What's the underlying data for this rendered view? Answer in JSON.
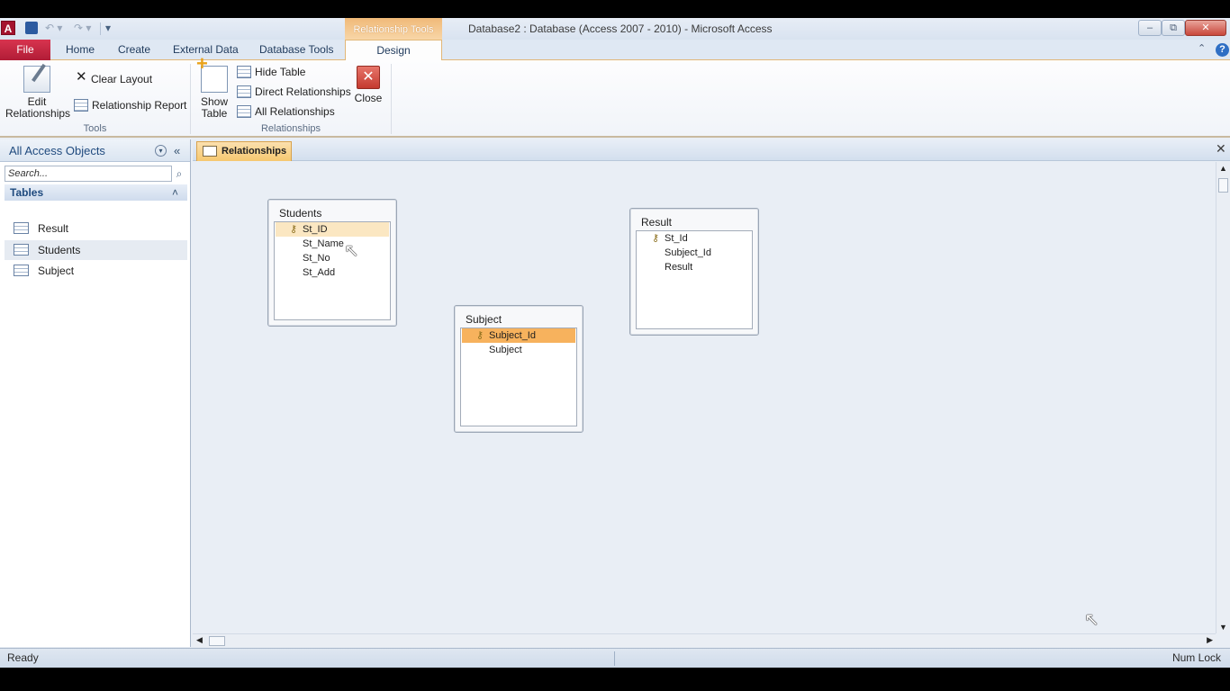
{
  "window": {
    "title": "Database2 : Database (Access 2007 - 2010)  -  Microsoft Access",
    "context_tab_header": "Relationship Tools",
    "app_letter": "A",
    "minimize": "–",
    "restore": "⧉",
    "close": "✕"
  },
  "quick_access": {
    "undo": "↶ ▾",
    "redo": "↷ ▾",
    "customize": "▾"
  },
  "ribbon_tabs": [
    "File",
    "Home",
    "Create",
    "External Data",
    "Database Tools",
    "Design"
  ],
  "ribbon": {
    "tools_group": "Tools",
    "relationships_group": "Relationships",
    "edit_relationships": [
      "Edit",
      "Relationships"
    ],
    "clear_layout": "Clear Layout",
    "relationship_report": "Relationship Report",
    "show_table": [
      "Show",
      "Table"
    ],
    "hide_table": "Hide Table",
    "direct_relationships": "Direct Relationships",
    "all_relationships": "All Relationships",
    "close": "Close",
    "close_glyph": "✕",
    "clear_glyph": "✕",
    "collapse_glyph": "⌃",
    "help_glyph": "?"
  },
  "nav": {
    "header": "All Access Objects",
    "menu_glyph": "▾",
    "collapse_glyph": "«",
    "search_placeholder": "Search...",
    "search_glyph": "⌕",
    "group": "Tables",
    "group_glyph": "˄",
    "items": [
      "Result",
      "Students",
      "Subject"
    ]
  },
  "document": {
    "tab": "Relationships",
    "close_glyph": "✕"
  },
  "tables": {
    "students": {
      "title": "Students",
      "fields": [
        "St_ID",
        "St_Name",
        "St_No",
        "St_Add"
      ]
    },
    "subject": {
      "title": "Subject",
      "fields": [
        "Subject_Id",
        "Subject"
      ]
    },
    "result": {
      "title": "Result",
      "fields": [
        "St_Id",
        "Subject_Id",
        "Result"
      ]
    }
  },
  "key_glyph": "⚷",
  "scroll": {
    "up": "▲",
    "down": "▼",
    "left": "◀",
    "right": "▶",
    "grip": "|||"
  },
  "status": {
    "left": "Ready",
    "right": "Num Lock"
  },
  "cursor_glyph": "↖"
}
